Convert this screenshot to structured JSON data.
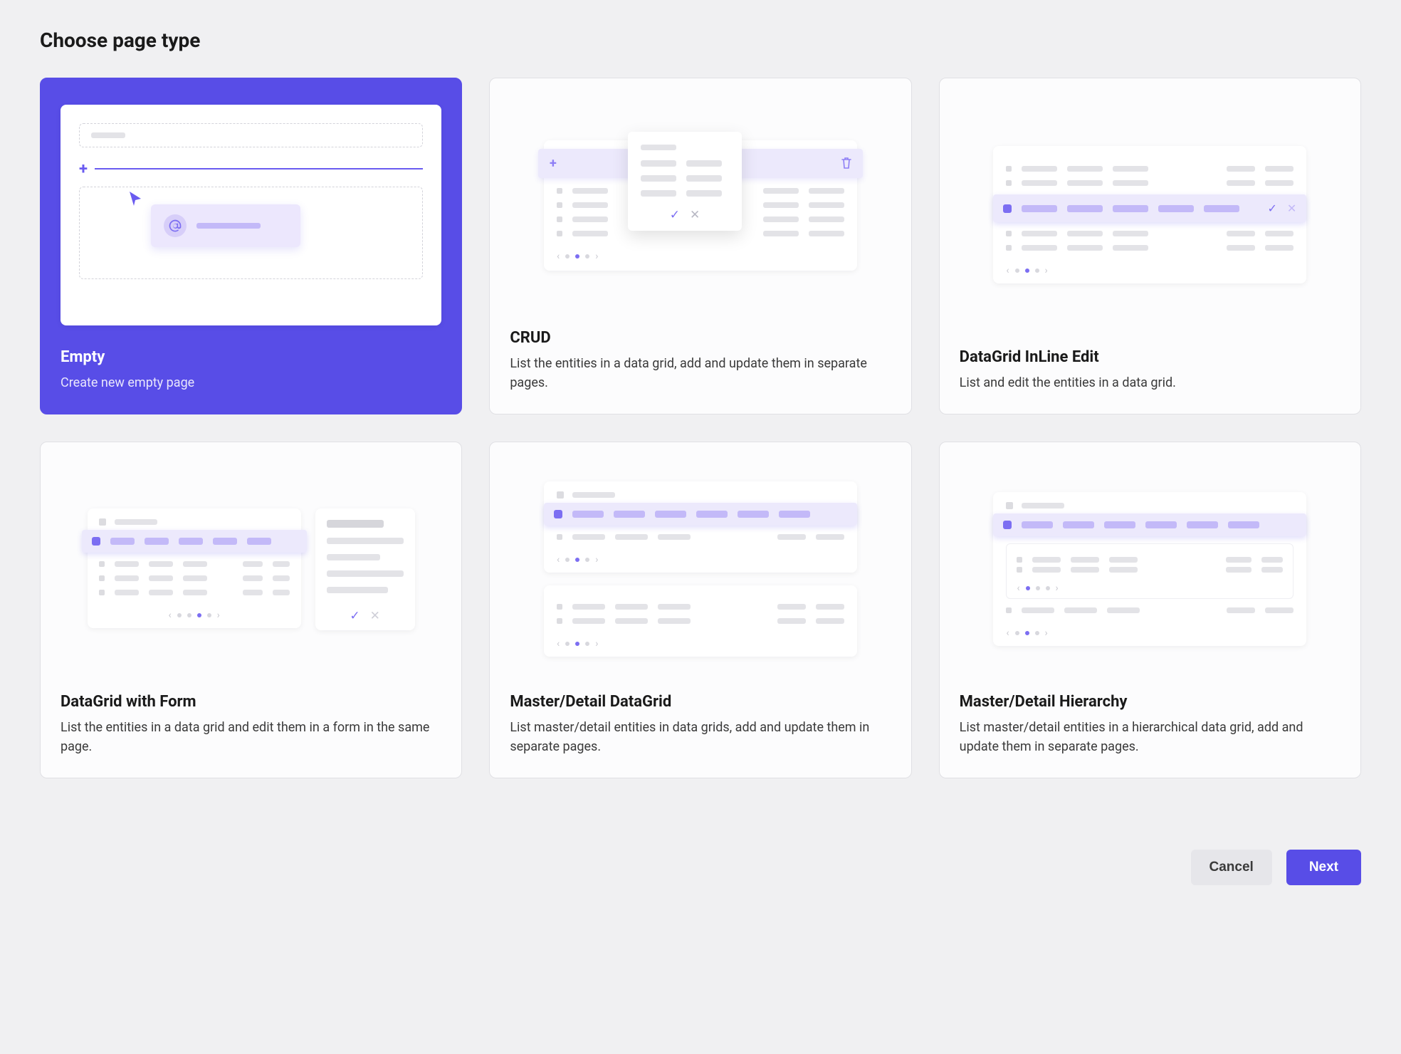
{
  "title": "Choose page type",
  "colors": {
    "primary": "#584de7",
    "accentLight": "#ece9fc",
    "border": "#e0e0e4"
  },
  "cards": [
    {
      "key": "empty",
      "title": "Empty",
      "description": "Create new empty page",
      "selected": true
    },
    {
      "key": "crud",
      "title": "CRUD",
      "description": "List the entities in a data grid, add and update them in separate pages.",
      "selected": false
    },
    {
      "key": "inline",
      "title": "DataGrid InLine Edit",
      "description": "List and edit the entities in a data grid.",
      "selected": false
    },
    {
      "key": "dgform",
      "title": "DataGrid with Form",
      "description": "List the entities in a data grid and edit them in a form in the same page.",
      "selected": false
    },
    {
      "key": "md_datagrid",
      "title": "Master/Detail DataGrid",
      "description": "List master/detail entities in data grids, add and update them in separate pages.",
      "selected": false
    },
    {
      "key": "md_hierarchy",
      "title": "Master/Detail Hierarchy",
      "description": "List master/detail entities in a hierarchical data grid, add and update them in separate pages.",
      "selected": false
    }
  ],
  "footer": {
    "cancel": "Cancel",
    "next": "Next"
  }
}
